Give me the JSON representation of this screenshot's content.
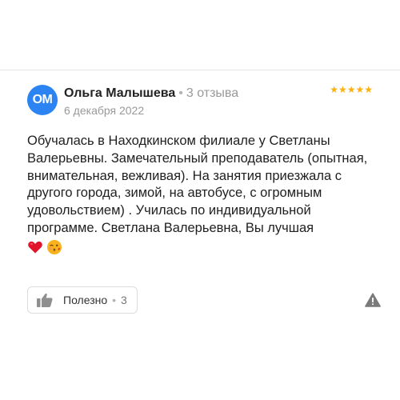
{
  "review": {
    "avatar_initials": "OM",
    "author": "Ольга Малышева",
    "separator": "•",
    "reviews_count": "3 отзыва",
    "date": "6 декабря 2022",
    "rating": 5,
    "stars_text": "★★★★★",
    "text": "Обучалась в Находкинском филиале у Светланы Валерьевны. Замечательный преподаватель (опытная, внимательная, вежливая). На занятия приезжала с другого города, зимой, на автобусе, с огромным удовольствием) . Училась по индивидуальной программе. Светлана Валерьевна, Вы лучшая",
    "emojis": [
      "heart-icon",
      "wink-kiss-icon"
    ]
  },
  "actions": {
    "like_label": "Полезно",
    "like_separator": "•",
    "like_count": "3"
  },
  "colors": {
    "avatar_bg": "#2c84f2",
    "stars": "#fcb10f",
    "heart": "#e0142b",
    "muted": "#999999"
  }
}
